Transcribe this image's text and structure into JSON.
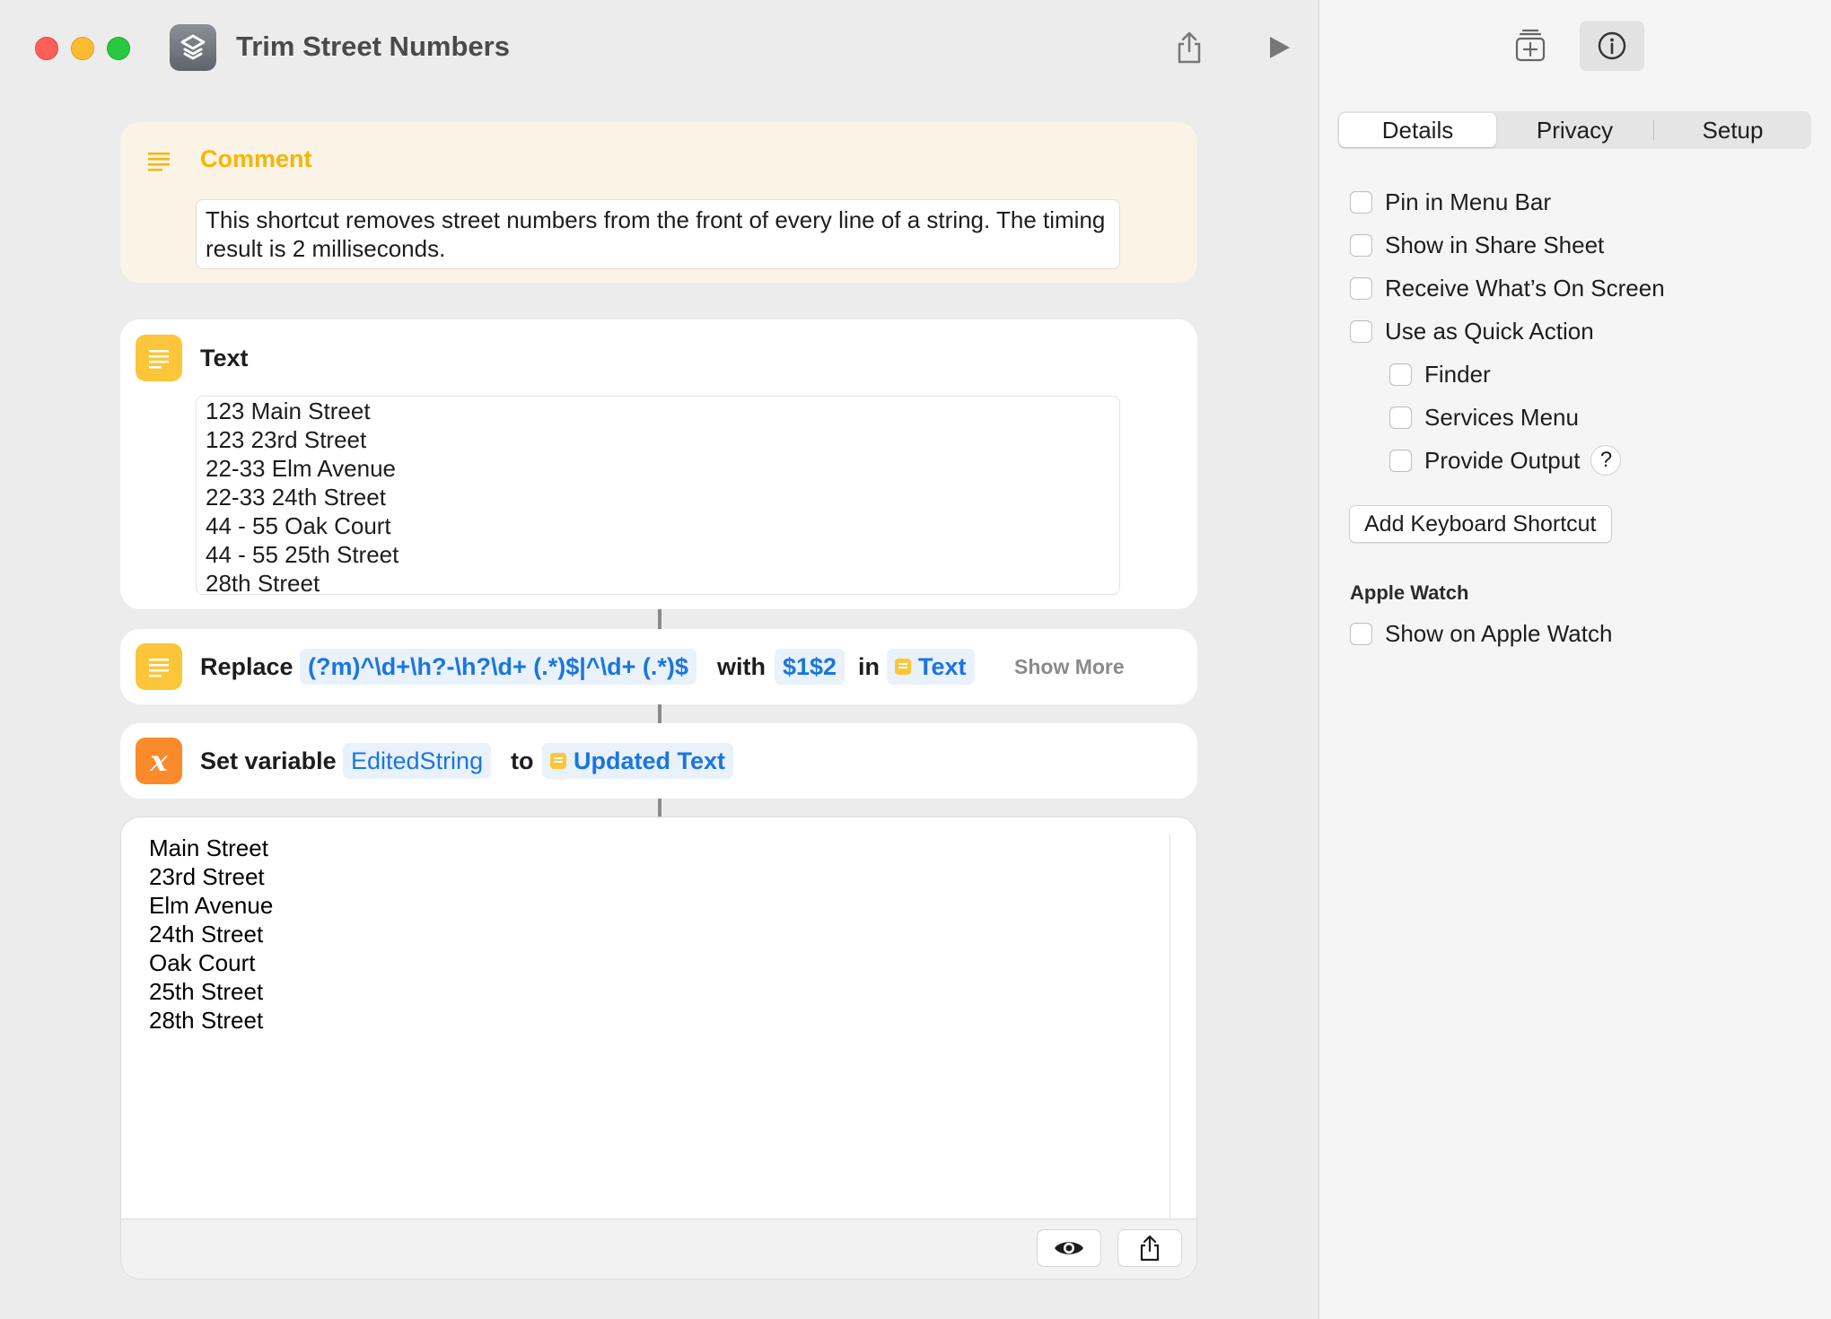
{
  "window": {
    "title": "Trim Street Numbers"
  },
  "actions": {
    "comment": {
      "title": "Comment",
      "text": "This shortcut removes street numbers from the front of every line of a string. The timing result is 2 milliseconds."
    },
    "text": {
      "title": "Text",
      "lines": [
        "123 Main Street",
        "123 23rd Street",
        "22-33 Elm Avenue",
        "22-33 24th Street",
        "44 - 55 Oak Court",
        "44 - 55 25th Street",
        "28th Street"
      ]
    },
    "replace": {
      "label": "Replace",
      "pattern": "(?m)^\\d+\\h?-\\h?\\d+ (.*)$|^\\d+ (.*)$",
      "with_label": "with",
      "replacement": "$1$2",
      "in_label": "in",
      "input": "Text",
      "show_more": "Show More"
    },
    "set_variable": {
      "label": "Set variable",
      "variable": "EditedString",
      "to_label": "to",
      "value": "Updated Text"
    },
    "output": {
      "lines": [
        "Main Street",
        "23rd Street",
        "Elm Avenue",
        "24th Street",
        "Oak Court",
        "25th Street",
        "28th Street"
      ]
    }
  },
  "inspector": {
    "tabs": [
      "Details",
      "Privacy",
      "Setup"
    ],
    "active_tab": "Details",
    "options": {
      "pin_menu_bar": "Pin in Menu Bar",
      "share_sheet": "Show in Share Sheet",
      "receive_screen": "Receive What’s On Screen",
      "quick_action": "Use as Quick Action",
      "finder": "Finder",
      "services_menu": "Services Menu",
      "provide_output": "Provide Output",
      "help": "?",
      "keyboard_shortcut": "Add Keyboard Shortcut",
      "apple_watch_heading": "Apple Watch",
      "show_apple_watch": "Show on Apple Watch"
    }
  },
  "colors": {
    "comment_title": "#f7b500",
    "token_text": "#1976e0",
    "yellow_icon": "#fcc53a",
    "orange_icon": "#fb8a2a"
  }
}
